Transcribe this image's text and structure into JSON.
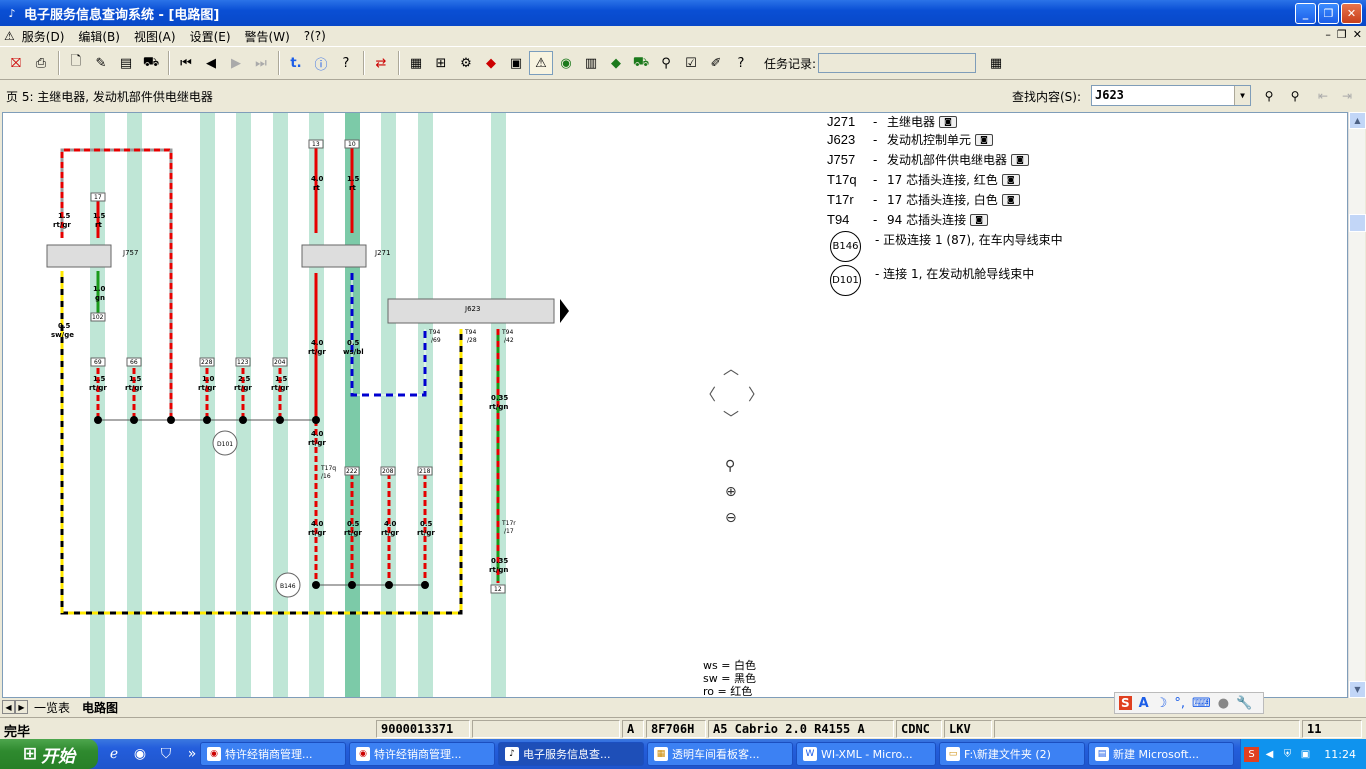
{
  "window": {
    "title": "电子服务信息查询系统 - [电路图]",
    "minimize_icon": "minimize-icon",
    "maximize_icon": "restore-icon",
    "close_icon": "close-icon"
  },
  "menu": {
    "items": [
      "服务(D)",
      "编辑(B)",
      "视图(A)",
      "设置(E)",
      "警告(W)",
      "?(?)"
    ]
  },
  "toolbar": {
    "task_label": "任务记录:",
    "task_value": ""
  },
  "pagebar": {
    "page_title": "页 5: 主继电器, 发动机部件供电继电器",
    "search_label": "查找内容(S):",
    "search_value": "J623"
  },
  "legend": [
    {
      "code": "J271",
      "desc": "主继电器"
    },
    {
      "code": "J623",
      "desc": "发动机控制单元"
    },
    {
      "code": "J757",
      "desc": "发动机部件供电继电器"
    },
    {
      "code": "T17q",
      "desc": "17 芯插头连接, 红色"
    },
    {
      "code": "T17r",
      "desc": "17 芯插头连接, 白色"
    },
    {
      "code": "T94",
      "desc": "94 芯插头连接"
    }
  ],
  "legend_circles": [
    {
      "code": "B146",
      "desc": "正极连接 1 (87), 在车内导线束中"
    },
    {
      "code": "D101",
      "desc": "连接 1, 在发动机舱导线束中"
    }
  ],
  "color_key": [
    {
      "abbr": "ws",
      "meaning": "白色"
    },
    {
      "abbr": "sw",
      "meaning": "黑色"
    },
    {
      "abbr": "ro",
      "meaning": "红色"
    }
  ],
  "diagram": {
    "components": {
      "J757": "J757",
      "J271": "J271",
      "J623": "J623",
      "D101": "D101",
      "B146": "B146"
    },
    "wire_labels": {
      "w1": {
        "size": "1.5",
        "color": "rt/gr"
      },
      "w2": {
        "size": "1.5",
        "color": "rt"
      },
      "w3": {
        "size": "1.0",
        "color": "gn"
      },
      "w4": {
        "size": "0.5",
        "color": "sw/ge"
      },
      "w5": {
        "size": "4.0",
        "color": "rt"
      },
      "w6": {
        "size": "1.5",
        "color": "rt"
      },
      "w7": {
        "size": "4.0",
        "color": "rt/gr"
      },
      "w8": {
        "size": "0.5",
        "color": "ws/bl"
      },
      "w9": {
        "size": "0.35",
        "color": "rt/gn"
      },
      "b1": {
        "size": "1.5",
        "color": "rt/gr"
      },
      "b2": {
        "size": "1.5",
        "color": "rt/gr"
      },
      "b3": {
        "size": "1.0",
        "color": "rt/gr"
      },
      "b4": {
        "size": "2.5",
        "color": "rt/gr"
      },
      "b5": {
        "size": "1.5",
        "color": "rt/gr"
      },
      "c1": {
        "size": "4.0",
        "color": "rt/gr"
      },
      "c2": {
        "size": "4.0",
        "color": "rt/gr"
      },
      "c3": {
        "size": "0.5",
        "color": "rt/gr"
      },
      "c4": {
        "size": "4.0",
        "color": "rt/gr"
      },
      "c5": {
        "size": "0.5",
        "color": "rt/gr"
      },
      "c6": {
        "size": "0.35",
        "color": "rt/gn"
      }
    },
    "terminals": {
      "t17": "17",
      "t13": "13",
      "t10": "10",
      "t102": "102",
      "t69": "69",
      "t66": "66",
      "t228": "228",
      "t123": "123",
      "t204": "204",
      "t222": "222",
      "t208": "208",
      "t218": "218",
      "t12": "12"
    },
    "pins": {
      "p1": "T94\n/69",
      "p2": "T94\n/28",
      "p3": "T94\n/42",
      "p4": "T17q\n/16",
      "p5": "T17r\n/17"
    }
  },
  "tabs": {
    "list_tab": "一览表",
    "diagram_tab": "电路图"
  },
  "ime": {
    "s": "S",
    "a": "A"
  },
  "status": {
    "state": "完毕",
    "id": "9000013371",
    "mode": "A",
    "code": "8F706H",
    "vehicle": "A5 Cabrio 2.0 R4155 A",
    "engine": "CDNC",
    "gearbox": "LKV",
    "page": "11"
  },
  "taskbar": {
    "start": "开始",
    "tasks": [
      "特许经销商管理...",
      "特许经销商管理...",
      "电子服务信息查...",
      "透明车间看板客...",
      "WI-XML - Micro...",
      "F:\\新建文件夹 (2)",
      "新建 Microsoft..."
    ],
    "clock": "11:24"
  },
  "colors": {
    "title_blue": "#0a4fd4",
    "wire_red": "#e60000",
    "ground_strip": "#bfe6d6",
    "wire_blue": "#0000d0",
    "wire_yellow": "#ffe800"
  }
}
